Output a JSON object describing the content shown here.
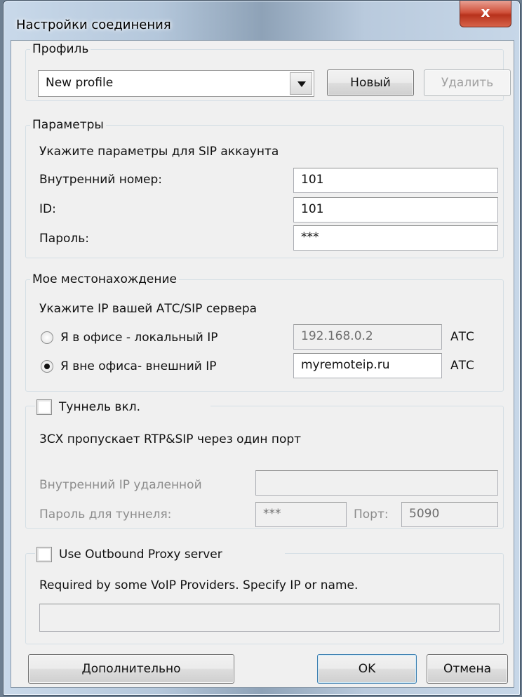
{
  "window": {
    "title": "Настройки соединения",
    "close_glyph": "x"
  },
  "profile": {
    "legend": "Профиль",
    "selected": "New profile",
    "new_label": "Новый",
    "delete_label": "Удалить"
  },
  "params": {
    "legend": "Параметры",
    "hint": "Укажите параметры для SIP аккаунта",
    "ext_label": "Внутренний номер:",
    "ext_value": "101",
    "id_label": "ID:",
    "id_value": "101",
    "pass_label": "Пароль:",
    "pass_value": "***"
  },
  "location": {
    "legend": "Мое местонахождение",
    "hint": "Укажите IP вашей АТС/SIP сервера",
    "local_label": "Я в офисе - локальный IP",
    "local_value": "192.168.0.2",
    "local_suffix": "АТС",
    "remote_label": "Я вне офиса- внешний IP",
    "remote_value": "myremoteip.ru",
    "remote_suffix": "АТС",
    "selected": "remote"
  },
  "tunnel": {
    "legend": "Туннель вкл.",
    "checked": false,
    "hint": "3CX пропускает RTP&SIP через один порт",
    "remote_ip_label": "Внутренний IP удаленной",
    "remote_ip_value": "",
    "pass_label": "Пароль для туннеля:",
    "pass_value": "***",
    "port_label": "Порт:",
    "port_value": "5090"
  },
  "proxy": {
    "legend": "Use Outbound Proxy server",
    "checked": false,
    "hint": "Required by some VoIP Providers. Specify IP or name.",
    "value": ""
  },
  "buttons": {
    "advanced": "Дополнительно",
    "ok": "OK",
    "cancel": "Отмена"
  }
}
